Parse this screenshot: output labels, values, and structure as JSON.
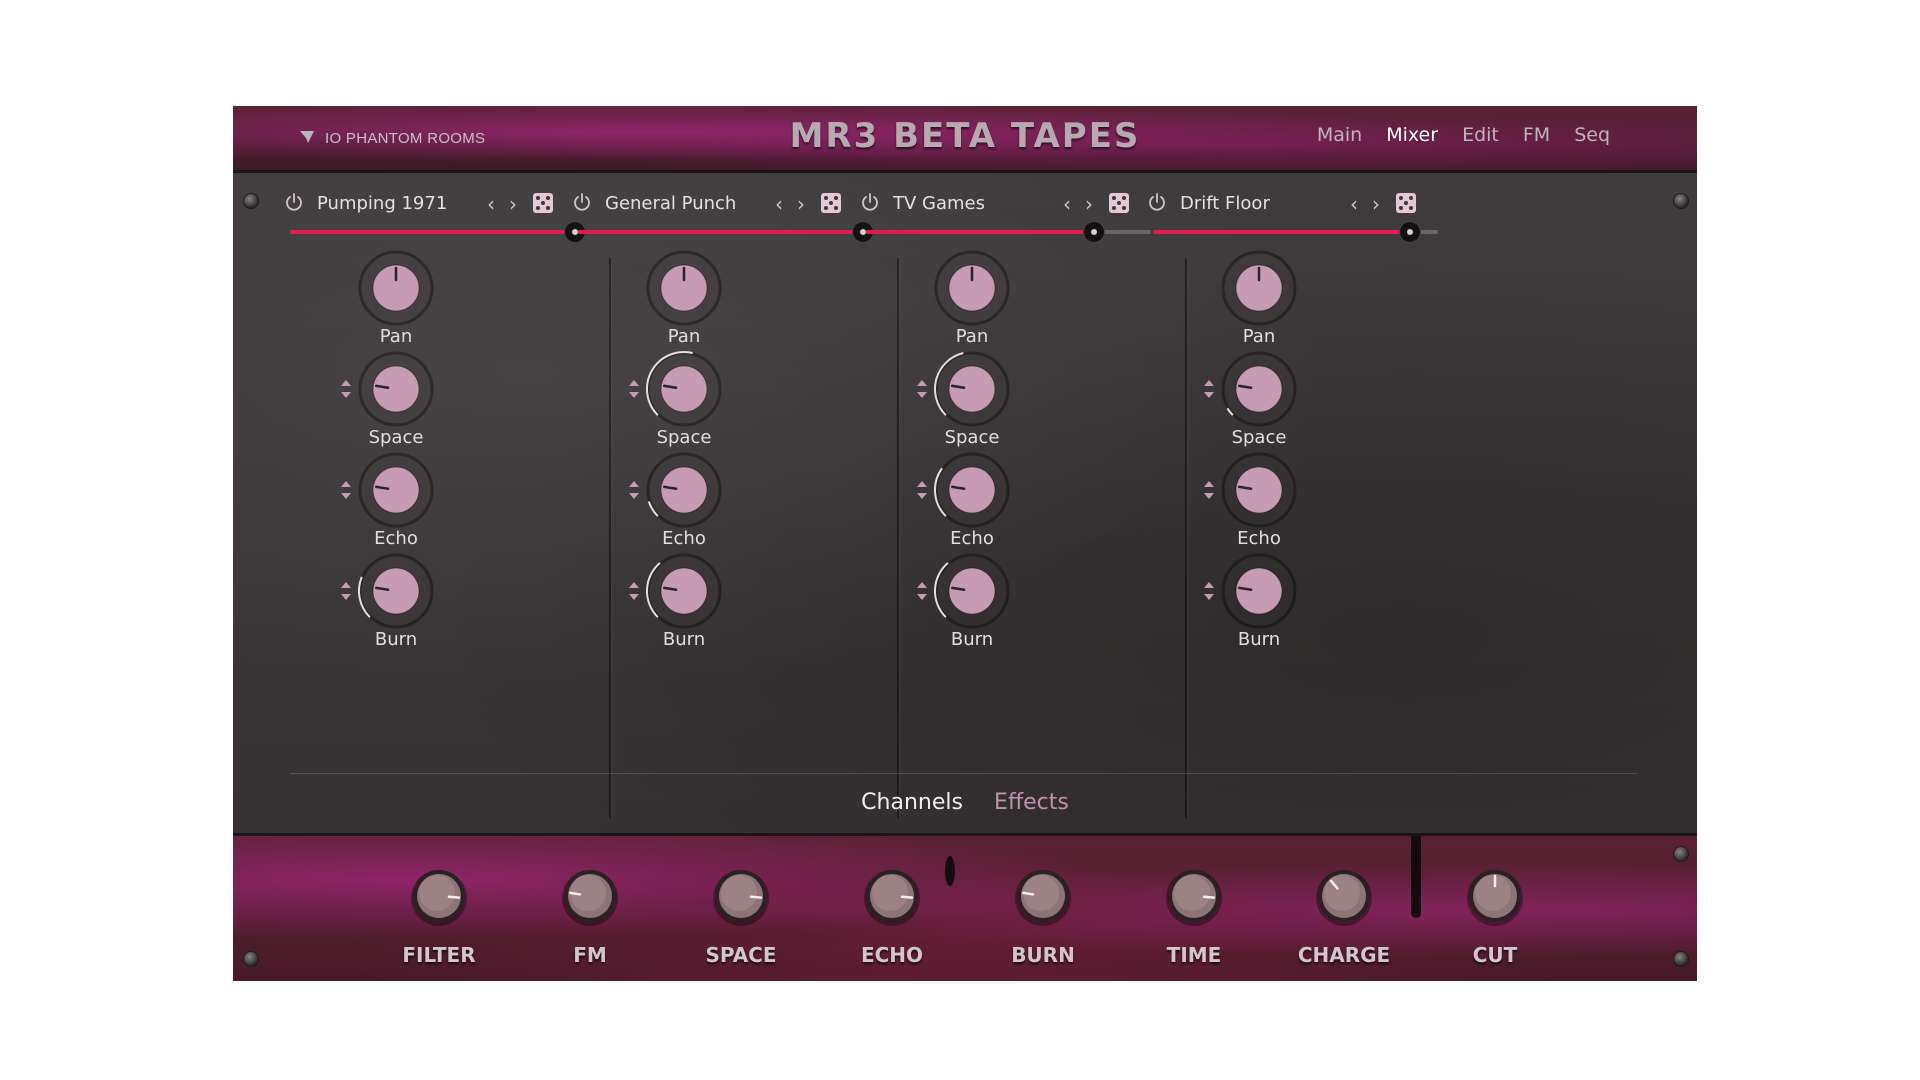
{
  "header": {
    "brand": "IO PHANTOM ROOMS",
    "title": "MR3 BETA TAPES",
    "nav": [
      {
        "label": "Main",
        "active": false
      },
      {
        "label": "Mixer",
        "active": true
      },
      {
        "label": "Edit",
        "active": false
      },
      {
        "label": "FM",
        "active": false
      },
      {
        "label": "Seq",
        "active": false
      }
    ]
  },
  "channels": [
    {
      "name": "Pumping 1971",
      "volume": 1.0,
      "knobs": [
        {
          "label": "Pan",
          "value": 0.5,
          "ring": 0.0
        },
        {
          "label": "Space",
          "value": 0.2,
          "ring": 0.0
        },
        {
          "label": "Echo",
          "value": 0.2,
          "ring": 0.0
        },
        {
          "label": "Burn",
          "value": 0.2,
          "ring": 0.25
        }
      ]
    },
    {
      "name": "General Punch",
      "volume": 1.0,
      "knobs": [
        {
          "label": "Pan",
          "value": 0.5,
          "ring": 0.0
        },
        {
          "label": "Space",
          "value": 0.2,
          "ring": 0.55
        },
        {
          "label": "Echo",
          "value": 0.2,
          "ring": 0.1
        },
        {
          "label": "Burn",
          "value": 0.2,
          "ring": 0.35
        }
      ]
    },
    {
      "name": "TV Games",
      "volume": 0.8,
      "knobs": [
        {
          "label": "Pan",
          "value": 0.5,
          "ring": 0.0
        },
        {
          "label": "Space",
          "value": 0.2,
          "ring": 0.45
        },
        {
          "label": "Echo",
          "value": 0.2,
          "ring": 0.3
        },
        {
          "label": "Burn",
          "value": 0.2,
          "ring": 0.35
        }
      ]
    },
    {
      "name": "Drift Floor",
      "volume": 0.9,
      "knobs": [
        {
          "label": "Pan",
          "value": 0.5,
          "ring": 0.0
        },
        {
          "label": "Space",
          "value": 0.2,
          "ring": 0.05
        },
        {
          "label": "Echo",
          "value": 0.2,
          "ring": 0.0
        },
        {
          "label": "Burn",
          "value": 0.2,
          "ring": 0.0
        }
      ]
    }
  ],
  "tabs": [
    {
      "label": "Channels",
      "active": true
    },
    {
      "label": "Effects",
      "active": false
    }
  ],
  "fx_knobs": [
    {
      "label": "FILTER",
      "value": 0.85
    },
    {
      "label": "FM",
      "value": 0.2
    },
    {
      "label": "SPACE",
      "value": 0.85
    },
    {
      "label": "ECHO",
      "value": 0.85
    },
    {
      "label": "BURN",
      "value": 0.2
    },
    {
      "label": "TIME",
      "value": 0.85
    },
    {
      "label": "CHARGE",
      "value": 0.35
    },
    {
      "label": "CUT",
      "value": 0.5
    }
  ],
  "colors": {
    "accent": "#e11c52",
    "knob": "#c79bb3",
    "panel": "#3b3738",
    "header": "#4e1d2c"
  }
}
